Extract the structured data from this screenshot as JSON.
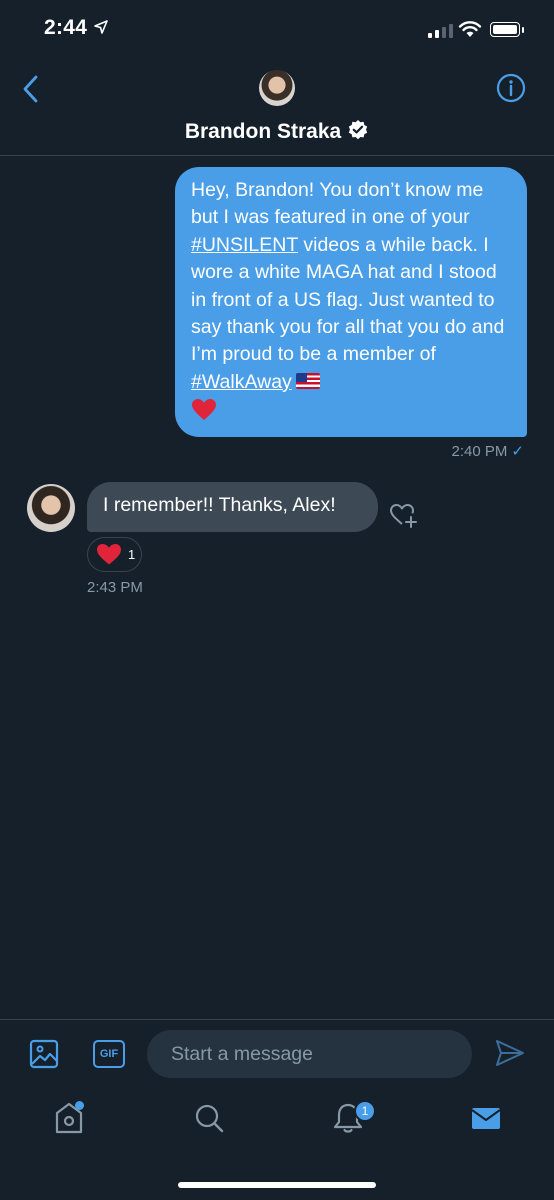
{
  "status": {
    "time": "2:44"
  },
  "header": {
    "name": "Brandon Straka"
  },
  "sent_message": {
    "p1": "Hey, Brandon! You don’t know me but I was featured in one of your ",
    "hashtag1": "#UNSILENT",
    "p2": " videos a while back. I wore a white MAGA hat and I stood in front of a US flag. Just wanted to say thank you for all that you do and I’m proud to be a member of ",
    "hashtag2": "#WalkAway",
    "time": "2:40 PM"
  },
  "received_message": {
    "text": "I remember!! Thanks, Alex!",
    "reaction_count": "1",
    "time": "2:43 PM"
  },
  "composer": {
    "placeholder": "Start a message",
    "gif_label": "GIF"
  },
  "tabbar": {
    "notification_count": "1"
  },
  "colors": {
    "background": "#15202b",
    "accent": "#4a9ee8",
    "received_bubble": "#3d4a56",
    "muted": "#8899a6"
  },
  "icons": [
    "location-arrow-icon",
    "signal-icon",
    "wifi-icon",
    "battery-icon",
    "back-icon",
    "info-icon",
    "verified-icon",
    "heart-icon",
    "add-reaction-icon",
    "image-icon",
    "gif-icon",
    "send-icon",
    "home-icon",
    "search-icon",
    "bell-icon",
    "mail-icon"
  ]
}
